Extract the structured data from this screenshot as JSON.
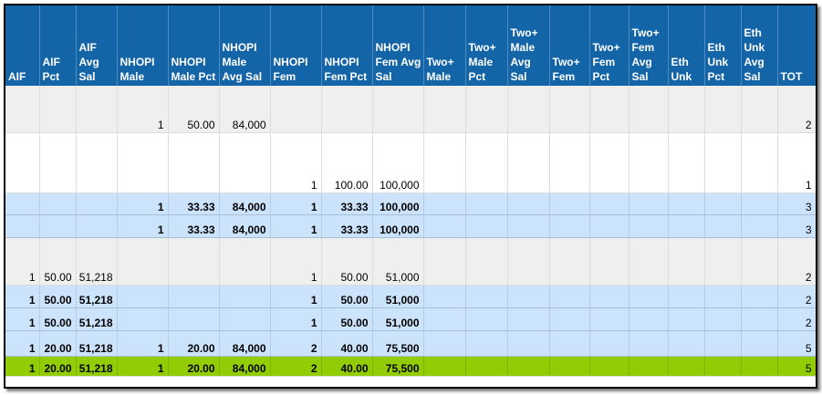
{
  "headers": [
    "AIF",
    "AIF Pct",
    "AIF Avg Sal",
    "NHOPI Male",
    "NHOPI Male Pct",
    "NHOPI Male Avg Sal",
    "NHOPI Fem",
    "NHOPI Fem Pct",
    "NHOPI Fem Avg Sal",
    "Two+ Male",
    "Two+ Male Pct",
    "Two+ Male Avg Sal",
    "Two+ Fem",
    "Two+ Fem Pct",
    "Two+ Fem Avg Sal",
    "Eth Unk",
    "Eth Unk Pct",
    "Eth Unk Avg Sal",
    "TOT"
  ],
  "rows": [
    [
      "",
      "",
      "",
      "1",
      "50.00",
      "84,000",
      "",
      "",
      "",
      "",
      "",
      "",
      "",
      "",
      "",
      "",
      "",
      "",
      "2"
    ],
    [
      "",
      "",
      "",
      "",
      "",
      "",
      "1",
      "100.00",
      "100,000",
      "",
      "",
      "",
      "",
      "",
      "",
      "",
      "",
      "",
      "1"
    ],
    [
      "",
      "",
      "",
      "1",
      "33.33",
      "84,000",
      "1",
      "33.33",
      "100,000",
      "",
      "",
      "",
      "",
      "",
      "",
      "",
      "",
      "",
      "3"
    ],
    [
      "",
      "",
      "",
      "1",
      "33.33",
      "84,000",
      "1",
      "33.33",
      "100,000",
      "",
      "",
      "",
      "",
      "",
      "",
      "",
      "",
      "",
      "3"
    ],
    [
      "1",
      "50.00",
      "51,218",
      "",
      "",
      "",
      "1",
      "50.00",
      "51,000",
      "",
      "",
      "",
      "",
      "",
      "",
      "",
      "",
      "",
      "2"
    ],
    [
      "1",
      "50.00",
      "51,218",
      "",
      "",
      "",
      "1",
      "50.00",
      "51,000",
      "",
      "",
      "",
      "",
      "",
      "",
      "",
      "",
      "",
      "2"
    ],
    [
      "1",
      "50.00",
      "51,218",
      "",
      "",
      "",
      "1",
      "50.00",
      "51,000",
      "",
      "",
      "",
      "",
      "",
      "",
      "",
      "",
      "",
      "2"
    ],
    [
      "1",
      "20.00",
      "51,218",
      "1",
      "20.00",
      "84,000",
      "2",
      "40.00",
      "75,500",
      "",
      "",
      "",
      "",
      "",
      "",
      "",
      "",
      "",
      "5"
    ],
    [
      "1",
      "20.00",
      "51,218",
      "1",
      "20.00",
      "84,000",
      "2",
      "40.00",
      "75,500",
      "",
      "",
      "",
      "",
      "",
      "",
      "",
      "",
      "",
      "5"
    ]
  ]
}
